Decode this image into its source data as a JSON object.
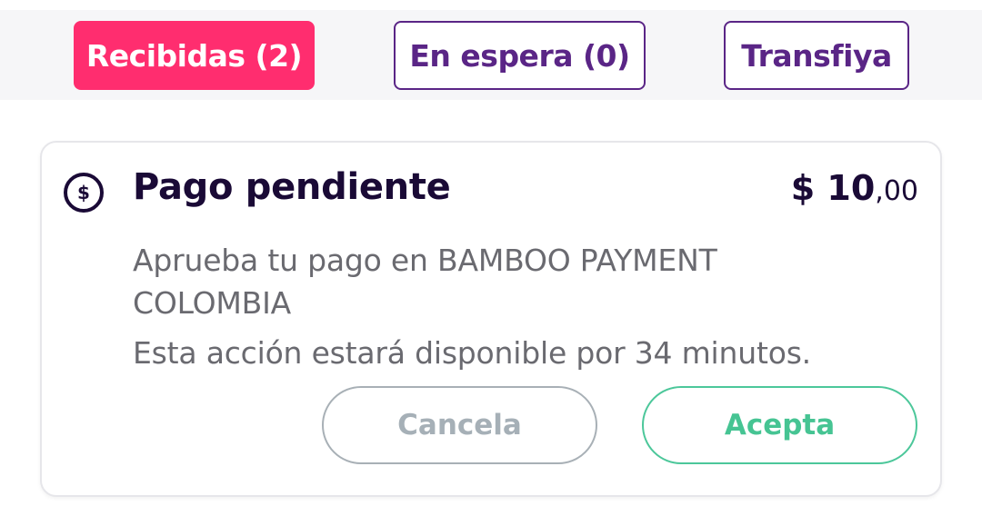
{
  "tabs": [
    {
      "label": "Recibidas (2)",
      "active": true
    },
    {
      "label": "En espera (0)",
      "active": false
    },
    {
      "label": "Transfiya",
      "active": false
    }
  ],
  "payment": {
    "icon": "dollar-circle-icon",
    "icon_glyph": "$",
    "title": "Pago pendiente",
    "amount_main": "$ 10",
    "amount_decimals": ",00",
    "description": "Aprueba tu pago en BAMBOO PAYMENT COLOMBIA",
    "availability": "Esta acción estará disponible por 34 minutos.",
    "cancel_label": "Cancela",
    "accept_label": "Acepta"
  },
  "colors": {
    "active_tab": "#ff2d6f",
    "tab_outline": "#5a2586",
    "title_text": "#1a0a36",
    "body_text": "#6a6a70",
    "cancel": "#a6b0b7",
    "accept": "#46c493"
  }
}
